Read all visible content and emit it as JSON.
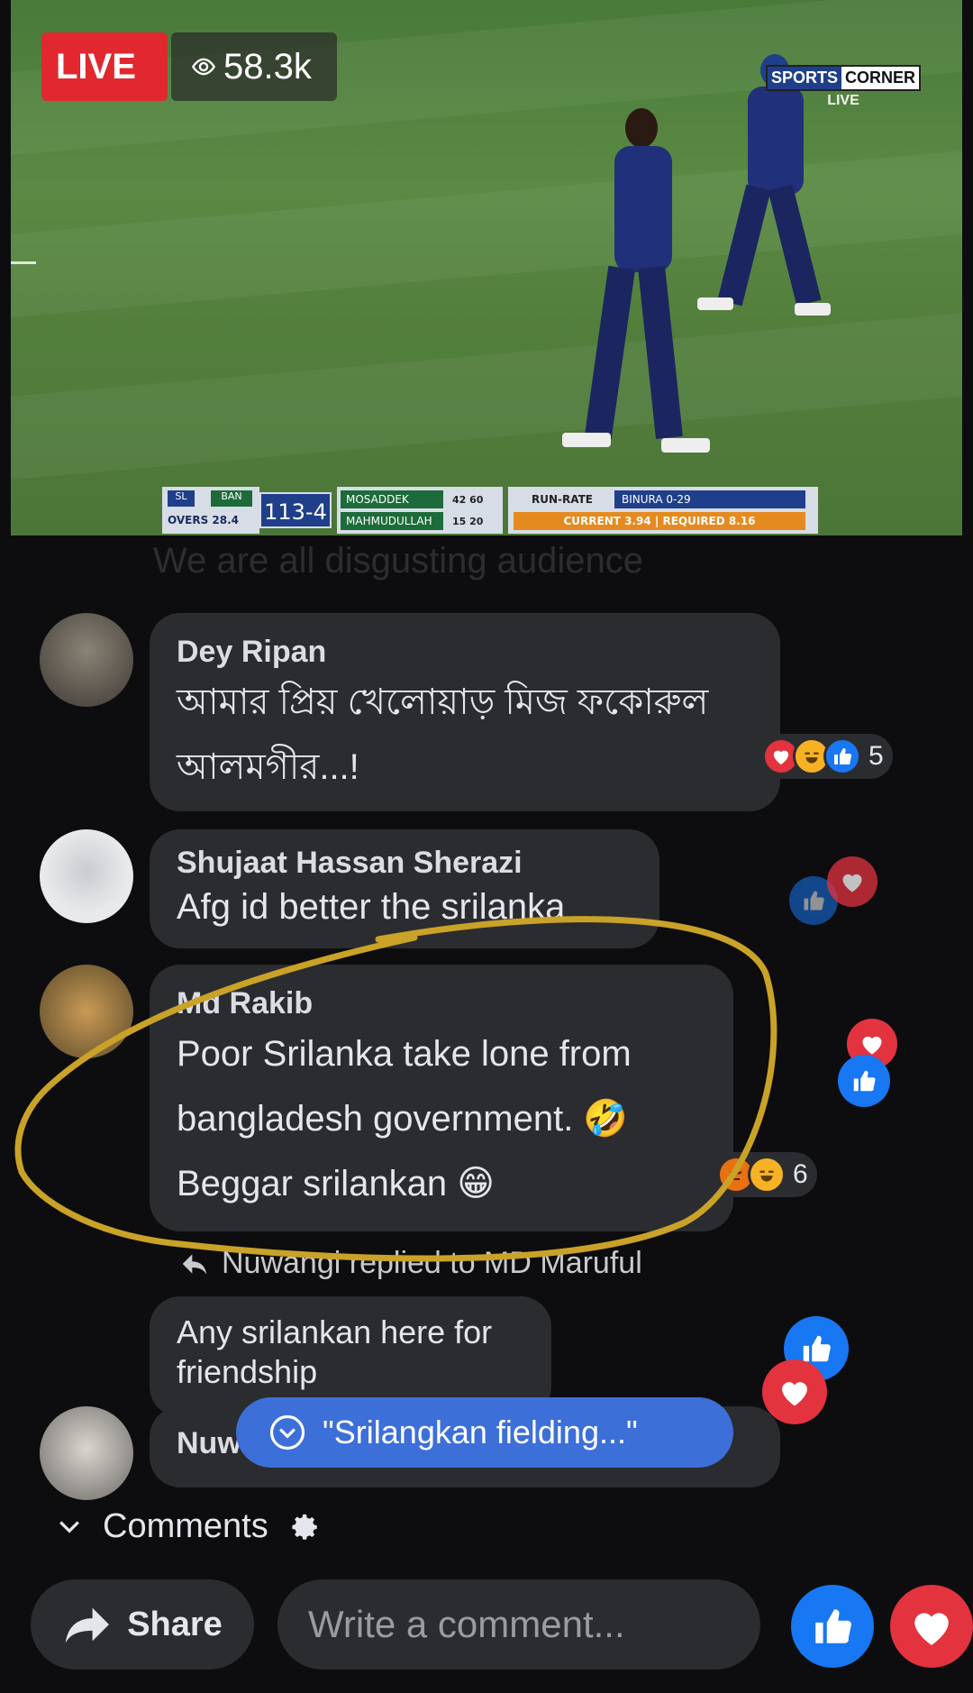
{
  "video": {
    "live_label": "LIVE",
    "viewer_count": "58.3k",
    "brand_a": "SPORTS",
    "brand_b": "CORNER",
    "brand_live": "LIVE",
    "scoreboard": {
      "team1": "SL",
      "team2": "BAN",
      "overs": "OVERS 28.4",
      "score": "113-4",
      "batsman1": "MOSADDEK",
      "batsman1_runs": "42 60",
      "batsman2": "MAHMUDULLAH",
      "batsman2_runs": "15 20",
      "run_rate_label": "RUN-RATE",
      "bowler": "BINURA 0-29",
      "rates": "CURRENT 3.94 | REQUIRED 8.16"
    }
  },
  "ghost_comment": "We are all disgusting audience",
  "comments": [
    {
      "author": "Dey Ripan",
      "text": "আমার প্রিয় খেলোয়াড় মিজ ফকোরুল\nআলমগীর...!",
      "reaction_count": "5"
    },
    {
      "author": "Shujaat Hassan Sherazi",
      "text": "Afg id better the srilanka"
    },
    {
      "author": "Md Rakib",
      "text": "Poor Srilanka take lone from\nbangladesh government. 🤣\nBeggar srilankan 😁",
      "reaction_count": "6"
    },
    {
      "reply_note": "Nuwangi replied to MD Maruful",
      "text": "Any srilankan here for\nfriendship"
    },
    {
      "author": "Nuw"
    }
  ],
  "toast": "\"Srilangkan fielding...\"",
  "comments_bar": {
    "label": "Comments"
  },
  "footer": {
    "share_label": "Share",
    "comment_placeholder": "Write a comment..."
  },
  "colors": {
    "accent_blue": "#1877f2",
    "love_red": "#e2333f",
    "live_red": "#e0282e",
    "highlight_yellow": "#c9a227"
  }
}
